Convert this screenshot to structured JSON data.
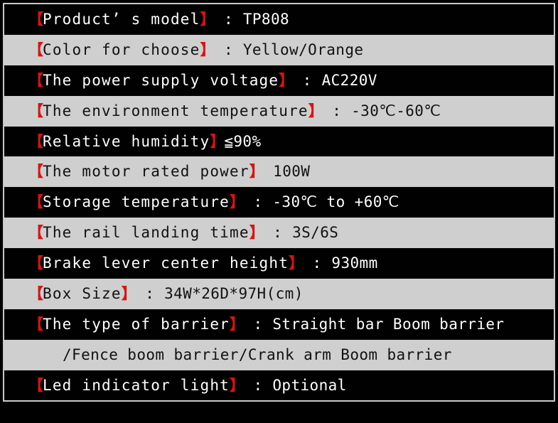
{
  "colors": {
    "background": "#000000",
    "frame_border": "#c9c9c9",
    "row_dark_bg": "#010101",
    "row_dark_text": "#ffffff",
    "row_light_bg": "#cfcfcf",
    "row_light_text": "#111111",
    "bracket_red": "#dd1111"
  },
  "spec_table": {
    "bracket_open": "【",
    "bracket_close": "】",
    "rows": [
      {
        "label": "Product’ s model",
        "separator": " : ",
        "value": "TP808",
        "theme": "dark",
        "indented": false
      },
      {
        "label": "Color for choose",
        "separator": " : ",
        "value": "Yellow/Orange",
        "theme": "light",
        "indented": false
      },
      {
        "label": "The power supply voltage",
        "separator": " : ",
        "value": "AC220V",
        "theme": "dark",
        "indented": false
      },
      {
        "label": "The environment temperature",
        "separator": " : ",
        "value": "-30℃-60℃",
        "theme": "light",
        "indented": false
      },
      {
        "label": "Relative humidity",
        "separator": "",
        "value": "≦90%",
        "theme": "dark",
        "indented": false
      },
      {
        "label": "The motor rated power",
        "separator": " ",
        "value": "100W",
        "theme": "light",
        "indented": false
      },
      {
        "label": "Storage temperature",
        "separator": " : ",
        "value": "-30℃ to +60℃",
        "theme": "dark",
        "indented": false
      },
      {
        "label": "The rail landing time",
        "separator": " : ",
        "value": "3S/6S",
        "theme": "light",
        "indented": false
      },
      {
        "label": "Brake lever center height",
        "separator": " : ",
        "value": "930mm",
        "theme": "dark",
        "indented": false
      },
      {
        "label": "Box Size",
        "separator": " : ",
        "value": "34W*26D*97H(cm)",
        "theme": "light",
        "indented": false
      },
      {
        "label": "The type of barrier",
        "separator": " : ",
        "value": "Straight bar Boom barrier",
        "theme": "dark",
        "indented": false
      },
      {
        "label": "",
        "separator": "",
        "value": "/Fence boom barrier/Crank arm Boom barrier",
        "theme": "light",
        "indented": true
      },
      {
        "label": "Led indicator light",
        "separator": " : ",
        "value": "Optional",
        "theme": "dark",
        "indented": false
      }
    ]
  }
}
